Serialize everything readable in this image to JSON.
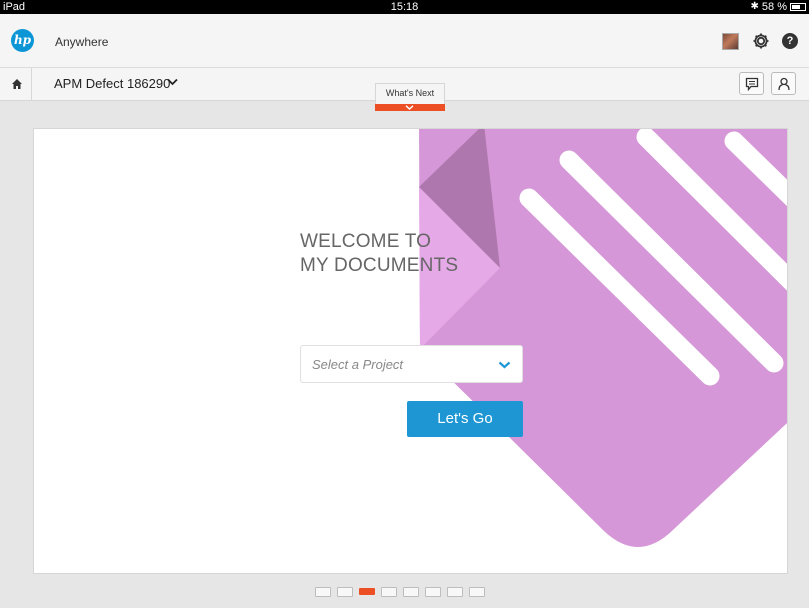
{
  "status_bar": {
    "device": "iPad",
    "time": "15:18",
    "battery_text": "58 %",
    "battery_level": 0.58
  },
  "app_bar": {
    "logo_text": "hp",
    "title": "Anywhere",
    "icons": [
      "avatar",
      "gear-icon",
      "help-icon"
    ]
  },
  "sub_bar": {
    "title": "APM Defect 186290",
    "icons": [
      "home-icon",
      "chevron-down-icon",
      "chat-icon",
      "user-icon"
    ]
  },
  "whats_next": {
    "label": "What's Next",
    "accent": "#ec4f24"
  },
  "welcome": {
    "line1": "WELCOME TO",
    "line2": "MY DOCUMENTS"
  },
  "project_select": {
    "placeholder": "Select a Project"
  },
  "go_button": {
    "label": "Let's Go",
    "color": "#1e96d4"
  },
  "illustration": {
    "colors": {
      "main": "#d597d7",
      "fold_dark": "#ae78ae",
      "fold_light": "#e6a9e8",
      "stripes": "#ffffff"
    }
  },
  "pager": {
    "total": 8,
    "active_index": 2
  }
}
